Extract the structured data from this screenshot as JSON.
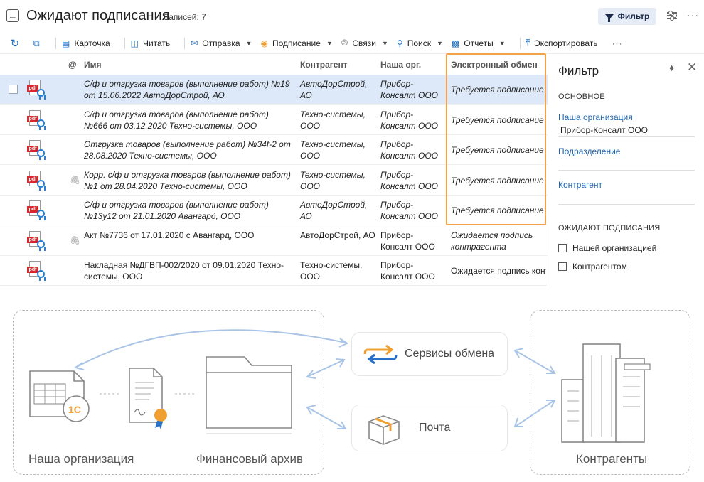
{
  "header": {
    "title": "Ожидают подписания",
    "records_label": "Записей:",
    "records_count": "7",
    "filter_label": "Фильтр"
  },
  "toolbar": {
    "items": [
      {
        "label": "Карточка",
        "icon": "card-icon"
      },
      {
        "label": "Читать",
        "icon": "book-icon"
      },
      {
        "label": "Отправка",
        "icon": "send-icon",
        "dropdown": true
      },
      {
        "label": "Подписание",
        "icon": "sign-icon",
        "dropdown": true
      },
      {
        "label": "Связи",
        "icon": "link-icon",
        "dropdown": true
      },
      {
        "label": "Поиск",
        "icon": "search-icon",
        "dropdown": true
      },
      {
        "label": "Отчеты",
        "icon": "report-icon",
        "dropdown": true
      },
      {
        "label": "Экспортировать",
        "icon": "export-icon"
      }
    ]
  },
  "table": {
    "columns": {
      "attach": "@",
      "name": "Имя",
      "agent": "Контрагент",
      "org": "Наша орг.",
      "exchange": "Электронный обмен"
    },
    "rows": [
      {
        "name": "С/ф и отгрузка товаров (выполнение работ) №19 от 15.06.2022 АвтоДорСтрой, АО",
        "agent": "АвтоДорСтрой, АО",
        "org": "Прибор-Консалт ООО",
        "exchange": "Требуется подписание",
        "italic": true,
        "clip": false,
        "selected": true
      },
      {
        "name": "С/ф и отгрузка товаров (выполнение работ) №666 от 03.12.2020 Техно-системы, ООО",
        "agent": "Техно-системы, ООО",
        "org": "Прибор-Консалт ООО",
        "exchange": "Требуется подписание",
        "italic": true,
        "clip": false,
        "selected": false
      },
      {
        "name": "Отгрузка товаров (выполнение работ) №34f-2 от 28.08.2020 Техно-системы, ООО",
        "agent": "Техно-системы, ООО",
        "org": "Прибор-Консалт ООО",
        "exchange": "Требуется подписание",
        "italic": true,
        "clip": false,
        "selected": false
      },
      {
        "name": "Корр. с/ф и отгрузка товаров (выполнение работ) №1 от 28.04.2020 Техно-системы, ООО",
        "agent": "Техно-системы, ООО",
        "org": "Прибор-Консалт ООО",
        "exchange": "Требуется подписание",
        "italic": true,
        "clip": true,
        "selected": false
      },
      {
        "name": "С/ф и отгрузка товаров (выполнение работ) №13у12 от 21.01.2020 Авангард, ООО",
        "agent": "АвтоДорСтрой, АО",
        "org": "Прибор-Консалт ООО",
        "exchange": "Требуется подписание",
        "italic": true,
        "clip": false,
        "selected": false
      },
      {
        "name": "Акт №7736 от 17.01.2020 с Авангард, ООО",
        "agent": "АвтоДорСтрой, АО",
        "org": "Прибор-Консалт ООО",
        "exchange": "Ожидается подпись контрагента",
        "italic": false,
        "clip": true,
        "selected": false
      },
      {
        "name": "Накладная №ДГВП-002/2020 от 09.01.2020 Техно-системы, ООО",
        "agent": "Техно-системы, ООО",
        "org": "Прибор-Консалт ООО",
        "exchange": "Ожидается подпись контрагента",
        "italic": false,
        "clip": false,
        "selected": false
      }
    ]
  },
  "filter_panel": {
    "title": "Фильтр",
    "section_main": "ОСНОВНОЕ",
    "org_label": "Наша организация",
    "org_value": "Прибор-Консалт ООО",
    "division_label": "Подразделение",
    "agent_label": "Контрагент",
    "section_waiting": "ОЖИДАЮТ ПОДПИСАНИЯ",
    "check_ours": "Нашей организацией",
    "check_agent": "Контрагентом"
  },
  "diagram": {
    "our_org": "Наша организация",
    "archive": "Финансовый архив",
    "exchange_services": "Сервисы обмена",
    "mail": "Почта",
    "counterparties": "Контрагенты",
    "logo_1c": "1С"
  },
  "colors": {
    "accent": "#1b6ec2",
    "highlight": "#f4a14b",
    "selected_row": "#dde9f8",
    "pdf_red": "#d9262c",
    "diagram_arrow": "#a9c4e6"
  }
}
